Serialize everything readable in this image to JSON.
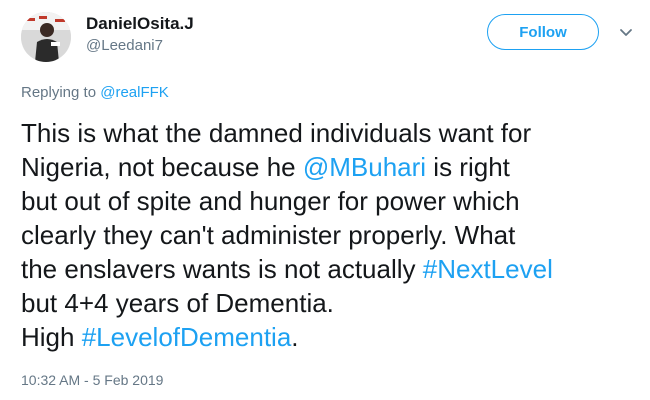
{
  "author": {
    "display_name": "DanielOsita.J",
    "handle": "@Leedani7",
    "avatar_icon": "user-avatar"
  },
  "follow_label": "Follow",
  "menu_icon": "chevron-down-icon",
  "reply": {
    "prefix": "Replying to ",
    "mention": "@realFFK"
  },
  "tweet": {
    "line1": "This is what the damned individuals want for",
    "line2_pre": "Nigeria, not because he ",
    "line2_mention": "@MBuhari",
    "line2_post": " is right",
    "line3": "but out of spite and hunger for power which",
    "line4": "clearly they can't administer properly. What",
    "line5_pre": "the enslavers wants is not actually ",
    "line5_hashtag": "#NextLevel",
    "line6": "but 4+4 years of Dementia.",
    "line7_pre": "High ",
    "line7_hashtag": "#LevelofDementia",
    "line7_post": "."
  },
  "timestamp": "10:32 AM - 5 Feb 2019",
  "colors": {
    "link": "#1da1f2",
    "text": "#14171a",
    "muted": "#657786"
  }
}
